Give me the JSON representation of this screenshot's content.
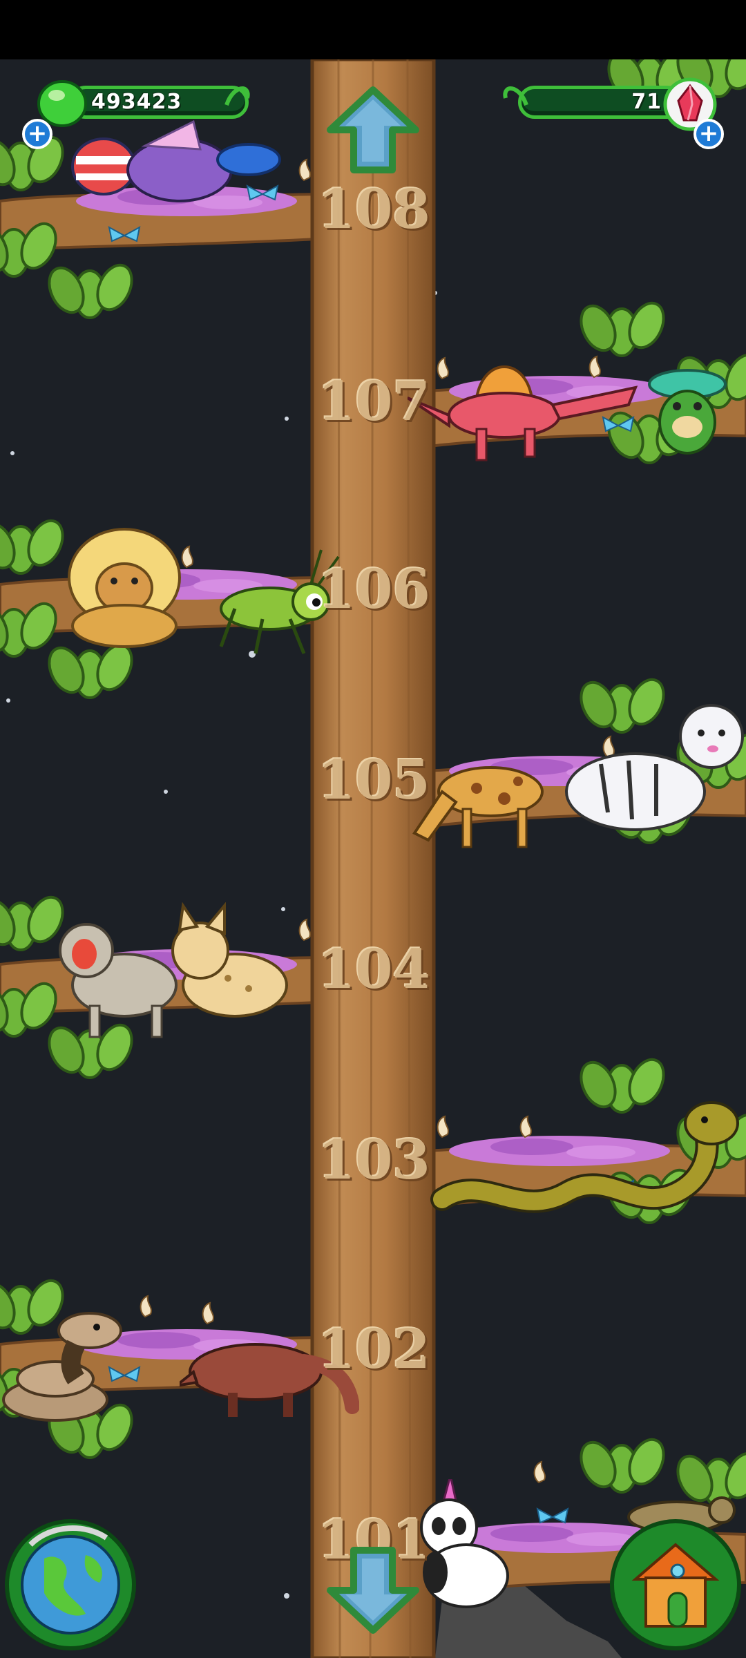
{
  "hud": {
    "gems_value": "493423",
    "gems_icon": "green-gem-icon",
    "rubies_value": "71",
    "rubies_icon": "red-crystal-icon",
    "plus_symbol": "+"
  },
  "tree": {
    "floors": [
      {
        "label": "108",
        "animals": [
          "clown-fish-icon",
          "purple-bird-icon",
          "blue-fish-icon"
        ]
      },
      {
        "label": "107",
        "animals": [
          "dimetrodon-dino-icon",
          "green-frog-icon"
        ]
      },
      {
        "label": "106",
        "animals": [
          "golden-lion-icon",
          "grasshopper-icon"
        ]
      },
      {
        "label": "105",
        "animals": [
          "giraffe-icon",
          "white-tiger-icon"
        ]
      },
      {
        "label": "104",
        "animals": [
          "macaque-monkey-icon",
          "lynx-icon"
        ]
      },
      {
        "label": "103",
        "animals": [
          "cobra-snake-icon"
        ]
      },
      {
        "label": "102",
        "animals": [
          "rattlesnake-icon",
          "anteater-icon"
        ]
      },
      {
        "label": "101",
        "animals": [
          "unicorn-panda-icon",
          "lizard-icon"
        ]
      }
    ]
  },
  "nav": {
    "up": "arrow-up-icon",
    "down": "arrow-down-icon",
    "globe": "globe-icon",
    "home": "house-icon"
  },
  "colors": {
    "sky": "#1c2026",
    "trunk": "#b07a44",
    "leaf": "#6fb73a",
    "hud_green": "#3fbf3a",
    "nest_pink": "#c97ad8",
    "butterfly": "#5fc8f0"
  }
}
